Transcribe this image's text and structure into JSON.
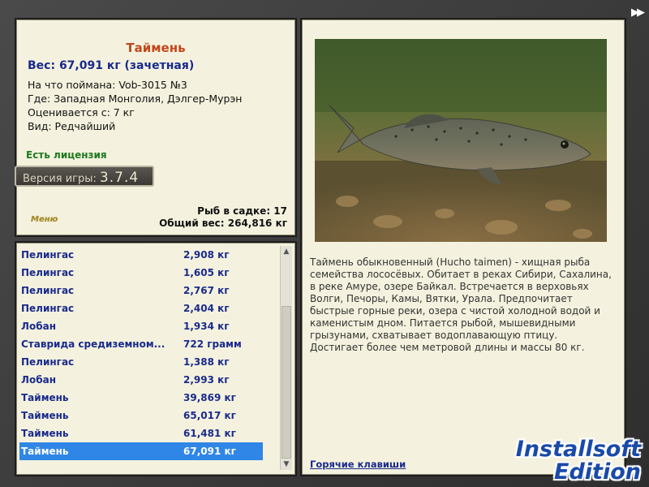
{
  "fish": {
    "title": "Таймень",
    "weight": "Вес: 67,091 кг (зачетная)",
    "caught_with": "На что поймана: Vob-3015 №3",
    "where": "Где: Западная Монголия, Дэлгер-Мурэн",
    "valued_from": "Оценивается с: 7 кг",
    "rarity": "Вид: Редчайший",
    "license": "Есть лицензия"
  },
  "version": {
    "label": "Версия игры:",
    "number": "3.7.4"
  },
  "menu_label": "Меню",
  "keep": {
    "count_label": "Рыб в садке: 17",
    "total_label": "Общий вес: 264,816 кг"
  },
  "catch_list": [
    {
      "name": "Пелингас",
      "weight": "2,908 кг"
    },
    {
      "name": "Пелингас",
      "weight": "1,605 кг"
    },
    {
      "name": "Пелингас",
      "weight": "2,767 кг"
    },
    {
      "name": "Пелингас",
      "weight": "2,404 кг"
    },
    {
      "name": "Лобан",
      "weight": "1,934 кг"
    },
    {
      "name": "Ставрида средиземном...",
      "weight": "722 грамм"
    },
    {
      "name": "Пелингас",
      "weight": "1,388 кг"
    },
    {
      "name": "Лобан",
      "weight": "2,993 кг"
    },
    {
      "name": "Таймень",
      "weight": "39,869 кг"
    },
    {
      "name": "Таймень",
      "weight": "65,017 кг"
    },
    {
      "name": "Таймень",
      "weight": "61,481 кг"
    },
    {
      "name": "Таймень",
      "weight": "67,091 кг"
    }
  ],
  "selected_index": 11,
  "description": "Таймень обыкновенный (Hucho taimen) - хищная рыба семейства лососёвых. Обитает в реках Сибири, Сахалина, в реке Амуре, озере Байкал. Встречается в верховьях Волги, Печоры, Камы, Вятки, Урала. Предпочитает быстрые горные реки, озера с чистой холодной водой и каменистым дном. Питается рыбой, мышевидными грызунами, схватывает водоплавающую птицу. Достигает более чем метровой длины и массы 80 кг.",
  "hotkeys_link": "Горячие клавиши",
  "watermark": {
    "line1": "Installsoft",
    "line2": "Edition"
  },
  "icons": {
    "fast_forward": "fast-forward-icon",
    "scroll_up": "scroll-up-icon",
    "scroll_down": "scroll-down-icon"
  }
}
